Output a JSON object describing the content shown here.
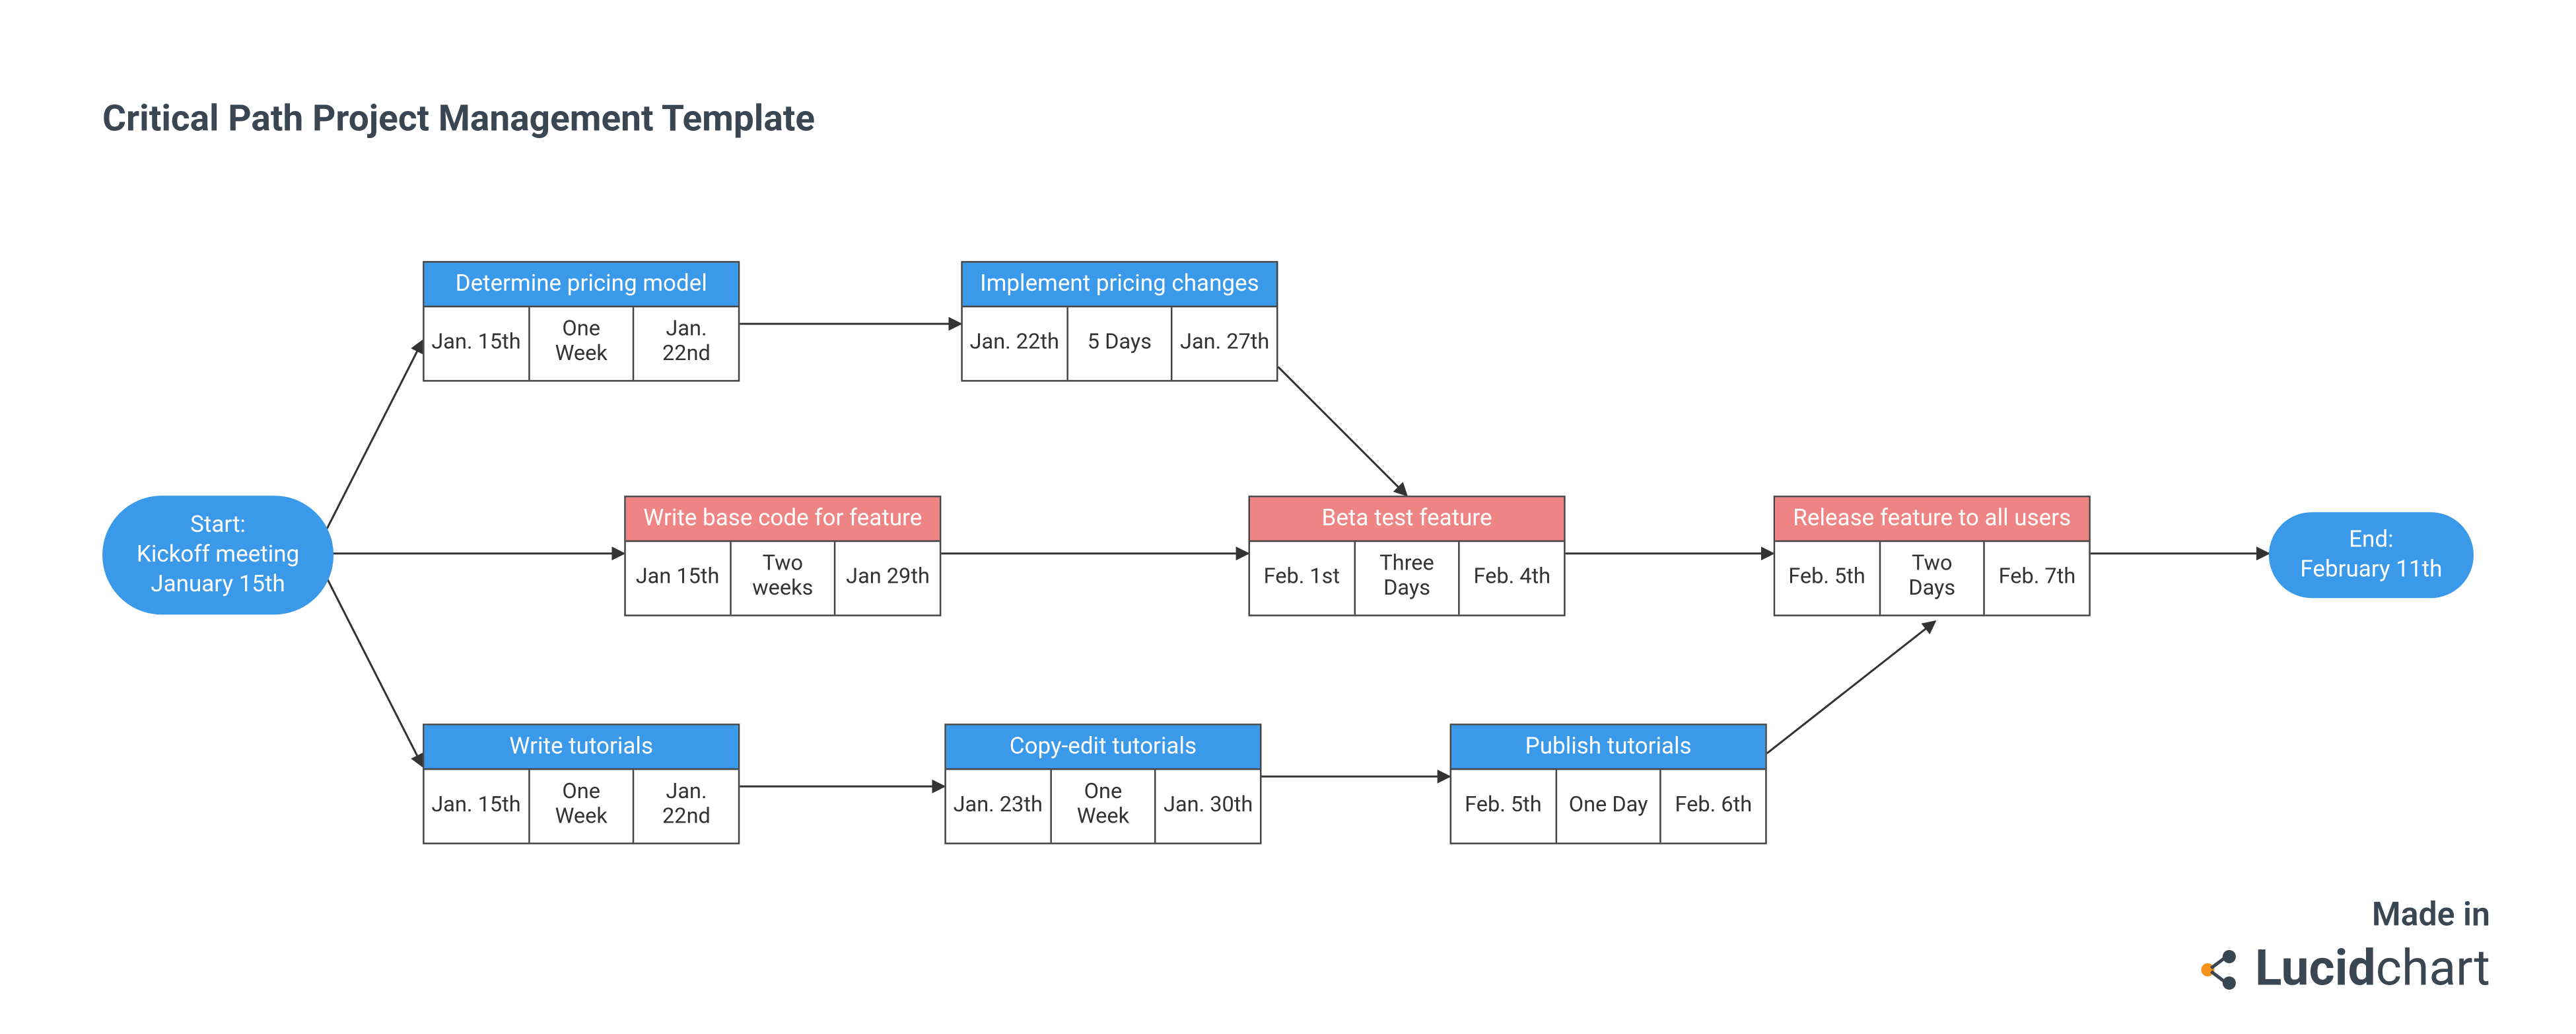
{
  "title": "Critical Path Project Management Template",
  "colors": {
    "blue": "#3b99e9",
    "red": "#ef8484"
  },
  "start": {
    "label_line1": "Start:",
    "label_line2": "Kickoff meeting",
    "label_line3": "January 15th"
  },
  "end": {
    "label_line1": "End:",
    "label_line2": "February 11th"
  },
  "tasks": {
    "determine_pricing": {
      "title": "Determine pricing model",
      "start": "Jan. 15th",
      "duration": "One Week",
      "end": "Jan. 22nd",
      "color": "blue"
    },
    "implement_pricing": {
      "title": "Implement pricing changes",
      "start": "Jan. 22th",
      "duration": "5 Days",
      "end": "Jan. 27th",
      "color": "blue"
    },
    "write_base_code": {
      "title": "Write base code for feature",
      "start": "Jan 15th",
      "duration": "Two weeks",
      "end": "Jan 29th",
      "color": "red"
    },
    "beta_test": {
      "title": "Beta test feature",
      "start": "Feb. 1st",
      "duration": "Three Days",
      "end": "Feb. 4th",
      "color": "red"
    },
    "release": {
      "title": "Release feature to all users",
      "start": "Feb. 5th",
      "duration": "Two Days",
      "end": "Feb. 7th",
      "color": "red"
    },
    "write_tutorials": {
      "title": "Write tutorials",
      "start": "Jan. 15th",
      "duration": "One Week",
      "end": "Jan. 22nd",
      "color": "blue"
    },
    "copyedit_tutorials": {
      "title": "Copy-edit tutorials",
      "start": "Jan. 23th",
      "duration": "One Week",
      "end": "Jan. 30th",
      "color": "blue"
    },
    "publish_tutorials": {
      "title": "Publish tutorials",
      "start": "Feb. 5th",
      "duration": "One Day",
      "end": "Feb. 6th",
      "color": "blue"
    }
  },
  "footer": {
    "made_in": "Made in",
    "brand_bold": "Lucid",
    "brand_rest": "chart"
  },
  "chart_data": {
    "type": "table",
    "title": "Critical Path Project Management Template",
    "nodes": [
      {
        "id": "start",
        "type": "terminator",
        "label": "Start: Kickoff meeting January 15th"
      },
      {
        "id": "t1",
        "type": "task",
        "label": "Determine pricing model",
        "start": "Jan. 15th",
        "duration": "One Week",
        "end": "Jan. 22nd",
        "critical": false
      },
      {
        "id": "t2",
        "type": "task",
        "label": "Implement pricing changes",
        "start": "Jan. 22th",
        "duration": "5 Days",
        "end": "Jan. 27th",
        "critical": false
      },
      {
        "id": "t3",
        "type": "task",
        "label": "Write base code for feature",
        "start": "Jan 15th",
        "duration": "Two weeks",
        "end": "Jan 29th",
        "critical": true
      },
      {
        "id": "t4",
        "type": "task",
        "label": "Beta test feature",
        "start": "Feb. 1st",
        "duration": "Three Days",
        "end": "Feb. 4th",
        "critical": true
      },
      {
        "id": "t5",
        "type": "task",
        "label": "Release feature to all users",
        "start": "Feb. 5th",
        "duration": "Two Days",
        "end": "Feb. 7th",
        "critical": true
      },
      {
        "id": "t6",
        "type": "task",
        "label": "Write tutorials",
        "start": "Jan. 15th",
        "duration": "One Week",
        "end": "Jan. 22nd",
        "critical": false
      },
      {
        "id": "t7",
        "type": "task",
        "label": "Copy-edit tutorials",
        "start": "Jan. 23th",
        "duration": "One Week",
        "end": "Jan. 30th",
        "critical": false
      },
      {
        "id": "t8",
        "type": "task",
        "label": "Publish tutorials",
        "start": "Feb. 5th",
        "duration": "One Day",
        "end": "Feb. 6th",
        "critical": false
      },
      {
        "id": "end",
        "type": "terminator",
        "label": "End: February 11th"
      }
    ],
    "edges": [
      [
        "start",
        "t1"
      ],
      [
        "start",
        "t3"
      ],
      [
        "start",
        "t6"
      ],
      [
        "t1",
        "t2"
      ],
      [
        "t2",
        "t4"
      ],
      [
        "t3",
        "t4"
      ],
      [
        "t4",
        "t5"
      ],
      [
        "t6",
        "t7"
      ],
      [
        "t7",
        "t8"
      ],
      [
        "t8",
        "t5"
      ],
      [
        "t5",
        "end"
      ]
    ]
  }
}
